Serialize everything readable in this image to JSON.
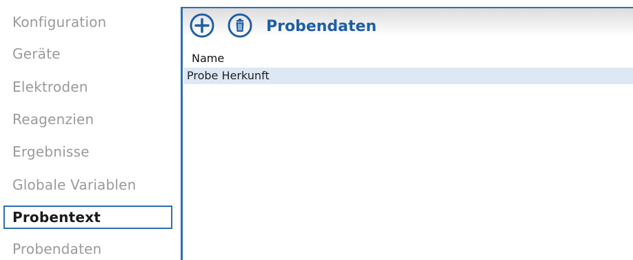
{
  "sidebar": {
    "items": [
      {
        "label": "Konfiguration"
      },
      {
        "label": "Geräte"
      },
      {
        "label": "Elektroden"
      },
      {
        "label": "Reagenzien"
      },
      {
        "label": "Ergebnisse"
      },
      {
        "label": "Globale Variablen"
      },
      {
        "label": "Probentext"
      },
      {
        "label": "Probendaten"
      }
    ],
    "active_index": 6
  },
  "panel": {
    "title": "Probendaten",
    "toolbar": {
      "add_icon": "plus-circle-icon",
      "delete_icon": "trash-circle-icon"
    },
    "table": {
      "columns": [
        "Name"
      ],
      "rows": [
        {
          "name": "Probe Herkunft"
        }
      ]
    }
  },
  "colors": {
    "accent": "#2a6fb2",
    "title": "#1f5fa3",
    "inactive_text": "#9a9a9a",
    "row_selected": "#dde8f4"
  }
}
